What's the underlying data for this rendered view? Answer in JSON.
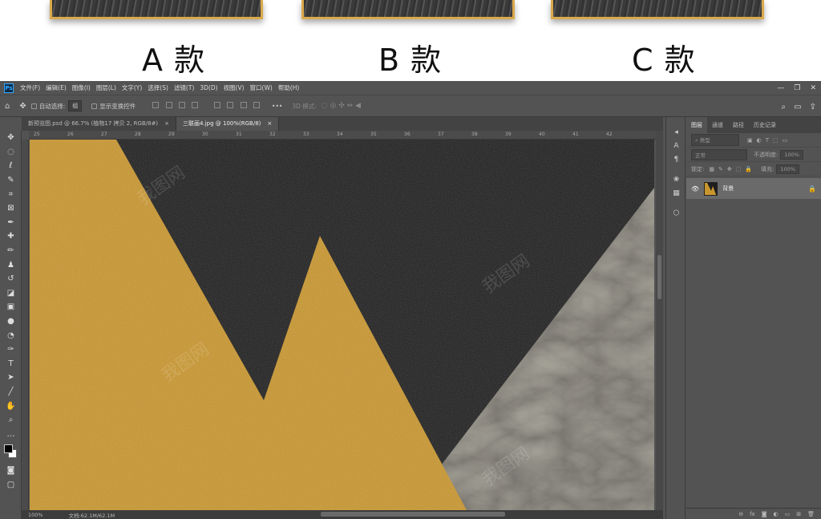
{
  "preview": {
    "labels": [
      "A 款",
      "B 款",
      "C 款"
    ]
  },
  "app": {
    "logo": "Ps",
    "menu": [
      "文件(F)",
      "编辑(E)",
      "图像(I)",
      "图层(L)",
      "文字(Y)",
      "选择(S)",
      "滤镜(T)",
      "3D(D)",
      "视图(V)",
      "窗口(W)",
      "帮助(H)"
    ],
    "window_controls": [
      "—",
      "❐",
      "✕"
    ]
  },
  "options": {
    "auto_select_label": "自动选择:",
    "auto_select_value": "组",
    "show_transform_label": "显示变换控件",
    "more": "•••",
    "mode_3d_label": "3D 模式:"
  },
  "tabs": [
    {
      "label": "新预览图.psd @ 66.7% (植物17 拷贝 2, RGB/8#)",
      "close": "×"
    },
    {
      "label": "三联画4.jpg @ 100%(RGB/8)",
      "close": "×"
    }
  ],
  "ruler_ticks": [
    "25",
    "26",
    "27",
    "28",
    "29",
    "30",
    "31",
    "32",
    "33",
    "34",
    "35",
    "36",
    "37",
    "38",
    "39",
    "40",
    "41",
    "42"
  ],
  "status": {
    "zoom": "100%",
    "doc": "文档:62.1M/62.1M"
  },
  "layers_panel": {
    "tabs": [
      "图层",
      "通道",
      "路径",
      "历史记录"
    ],
    "filter_label": "类型",
    "blend_mode": "正常",
    "opacity_label": "不透明度:",
    "opacity_value": "100%",
    "lock_label": "锁定:",
    "fill_label": "填充:",
    "fill_value": "100%",
    "layer_name": "背景"
  },
  "watermark": "我图网",
  "colors": {
    "gold": "#c9962e",
    "dark": "#1f1f1f",
    "marble": "#4a463f",
    "frame": "#d9a94b"
  }
}
